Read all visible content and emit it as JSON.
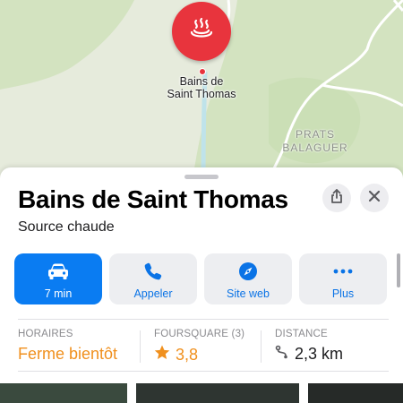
{
  "map": {
    "pin_icon": "hot-spring-icon",
    "pin_label_line1": "Bains de",
    "pin_label_line2": "Saint Thomas",
    "place_label_line1": "PRATS",
    "place_label_line2": "BALAGUER",
    "colors": {
      "pin": "#e8343d",
      "land": "#e6ebdc",
      "forest": "#d3e3c0",
      "water": "#bfe3ea",
      "road": "#ffffff"
    }
  },
  "sheet": {
    "title": "Bains de Saint Thomas",
    "subtitle": "Source chaude",
    "share_icon": "share-icon",
    "close_icon": "close-icon"
  },
  "actions": [
    {
      "label": "7 min",
      "icon": "car-icon"
    },
    {
      "label": "Appeler",
      "icon": "phone-icon"
    },
    {
      "label": "Site web",
      "icon": "compass-icon"
    },
    {
      "label": "Plus",
      "icon": "more-icon"
    }
  ],
  "info": {
    "hours_header": "HORAIRES",
    "hours_value": "Ferme bientôt",
    "rating_header": "FOURSQUARE (3)",
    "rating_value": "3,8",
    "distance_header": "DISTANCE",
    "distance_value": "2,3 km"
  },
  "colors": {
    "accent": "#0a7cf2",
    "warning": "#f0901e",
    "muted": "#8a8a8e"
  }
}
